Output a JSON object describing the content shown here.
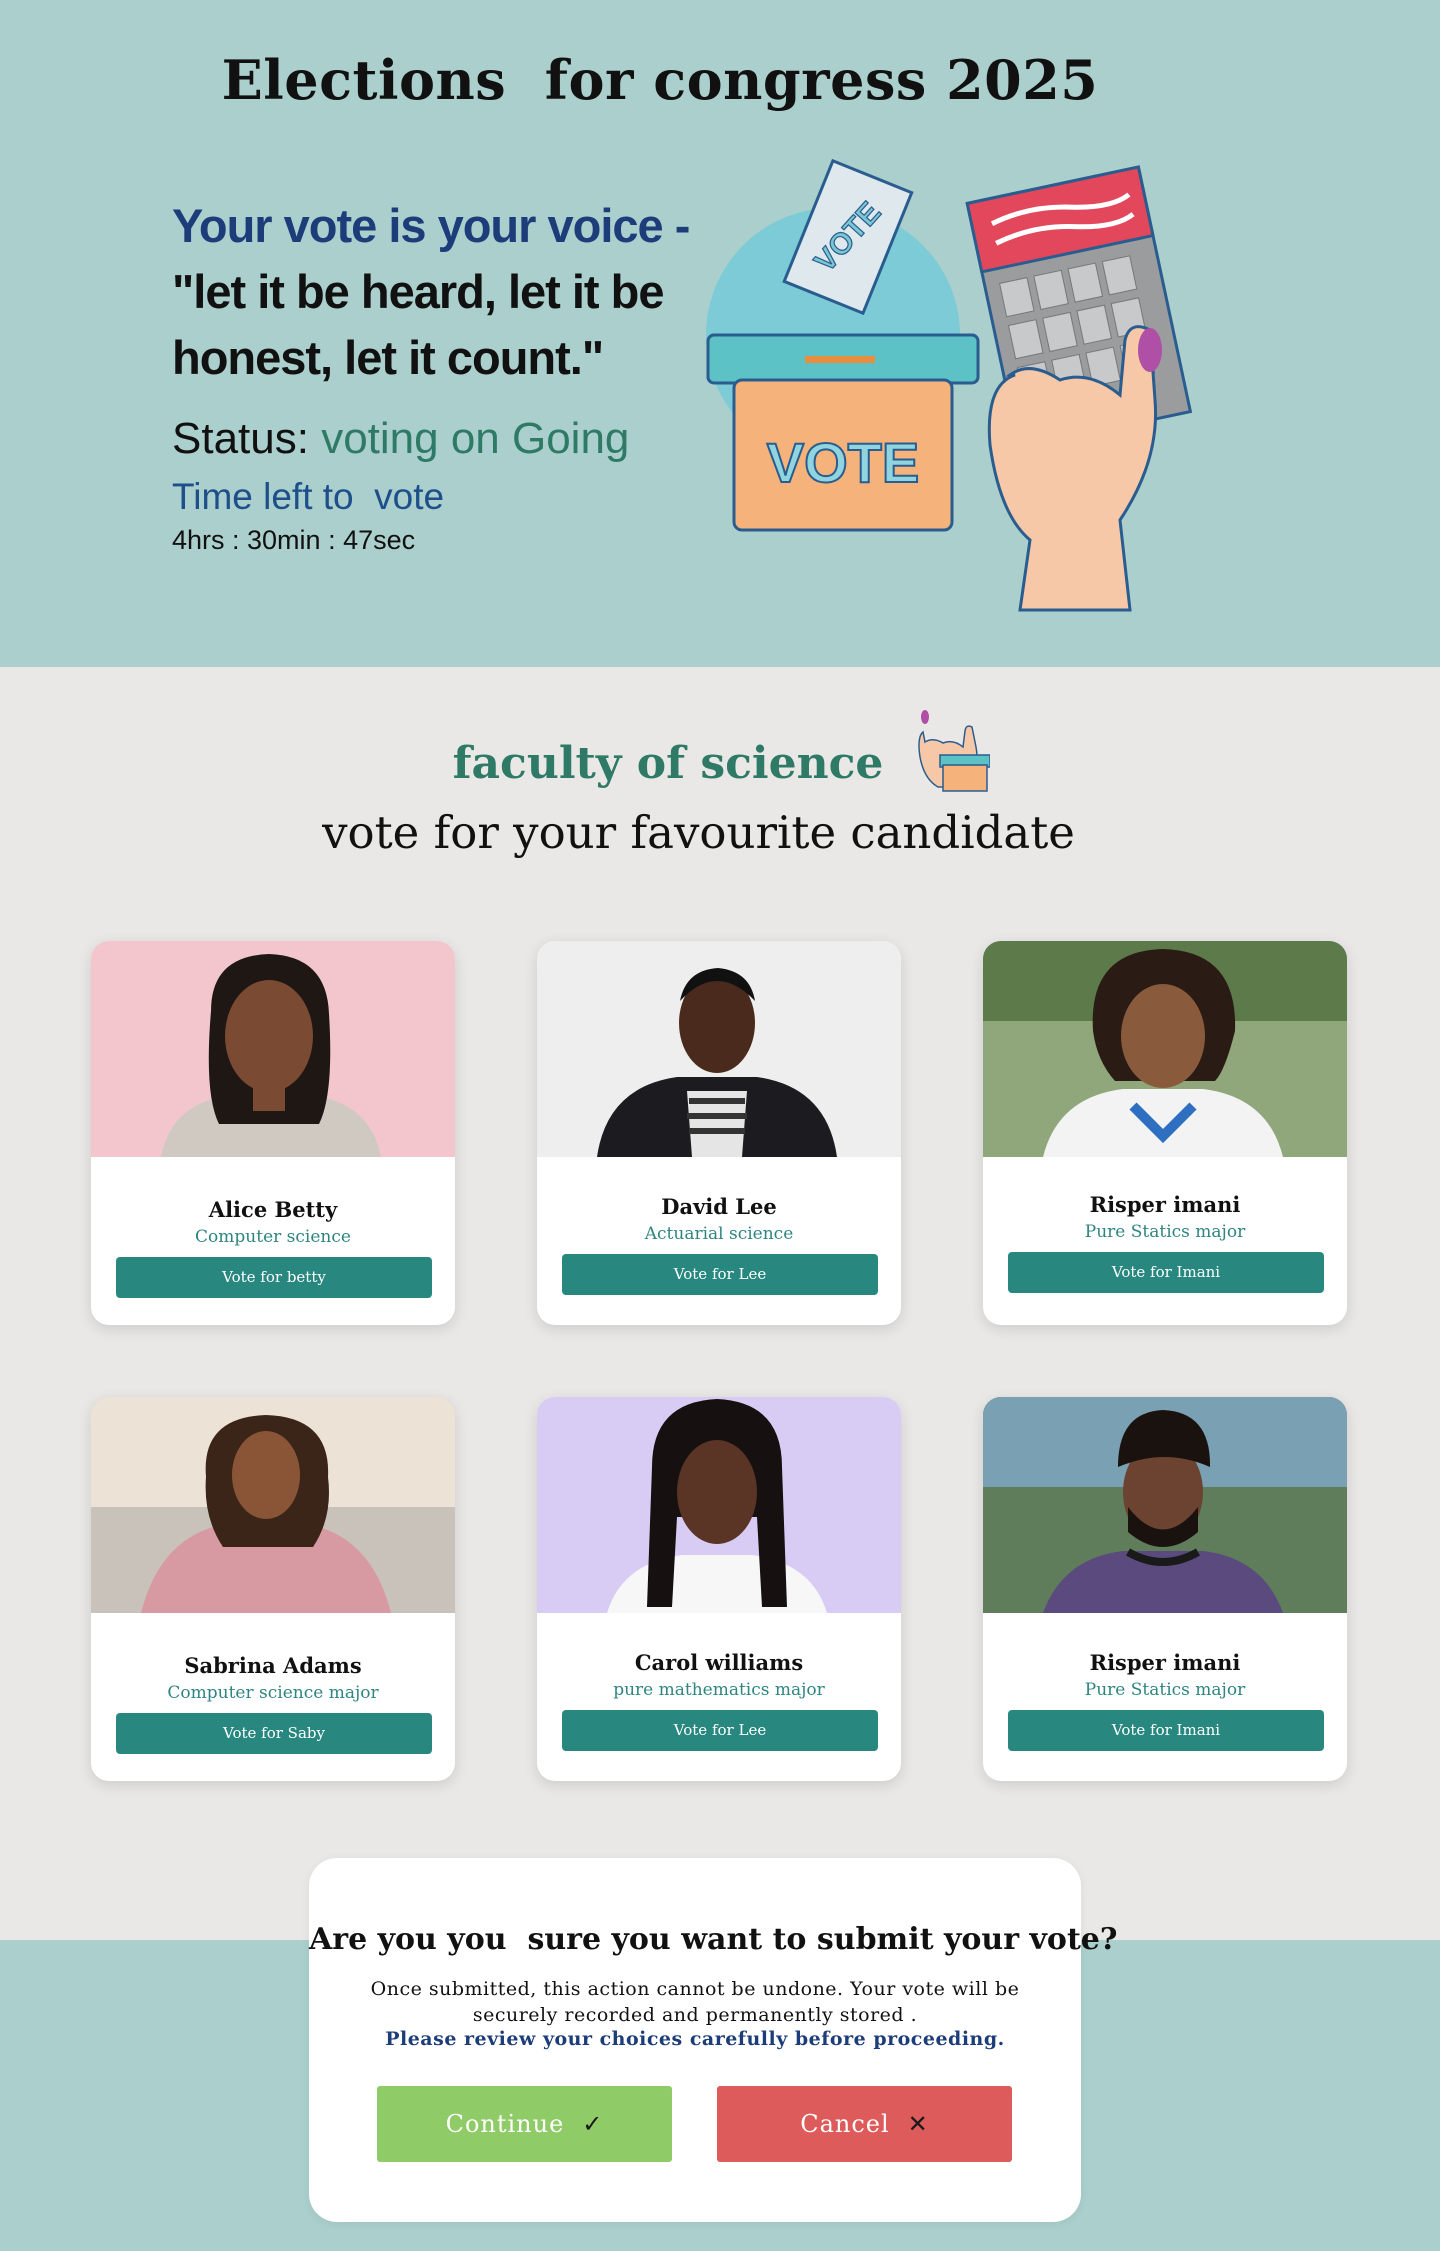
{
  "header": {
    "title": "Elections  for congress 2025",
    "slogan_line1": "Your vote is your voice -",
    "slogan_line2": "\"let it be heard, let it be honest, let it count.\"",
    "status_label": "Status: ",
    "status_value": "voting on Going",
    "time_label": "Time left to  vote",
    "countdown": "4hrs : 30min : 47sec",
    "illustration": {
      "box_label": "VOTE",
      "ballot_label": "VOTE",
      "icon": "ballot-box-illustration"
    }
  },
  "section": {
    "faculty": "faculty of science",
    "subtitle": "vote for your favourite candidate",
    "icon": "vote-hand-icon"
  },
  "candidates": [
    {
      "name": "Alice Betty",
      "major": "Computer science",
      "button": "Vote for betty",
      "photo_bg": "#f2c6cc"
    },
    {
      "name": "David Lee",
      "major": "Actuarial science",
      "button": "Vote for Lee",
      "photo_bg": "#eeeeee"
    },
    {
      "name": "Risper imani",
      "major": "Pure Statics major",
      "button": "Vote for Imani",
      "photo_bg": "#8fa77a"
    },
    {
      "name": "Sabrina Adams",
      "major": "Computer science major",
      "button": "Vote for Saby",
      "photo_bg": "#c9c2bb"
    },
    {
      "name": "Carol williams",
      "major": "pure mathematics major",
      "button": "Vote for Lee",
      "photo_bg": "#d8ccf5"
    },
    {
      "name": "Risper imani",
      "major": "Pure Statics major",
      "button": "Vote for Imani",
      "photo_bg": "#5f7d5a"
    }
  ],
  "dialog": {
    "question": "Are you you  sure you want to submit your vote?",
    "body_line1": "Once submitted, this action cannot be undone. Your vote will be",
    "body_line2": "securely recorded and permanently stored .",
    "review": "Please review your choices carefully before proceeding.",
    "continue_label": "Continue",
    "continue_icon": "check-icon",
    "cancel_label": "Cancel",
    "cancel_icon": "close-icon"
  },
  "colors": {
    "teal_bg": "#abcfcc",
    "page_bg": "#e9e8e6",
    "accent": "#28877f",
    "continue": "#8fcb67",
    "cancel": "#de5b5b"
  }
}
